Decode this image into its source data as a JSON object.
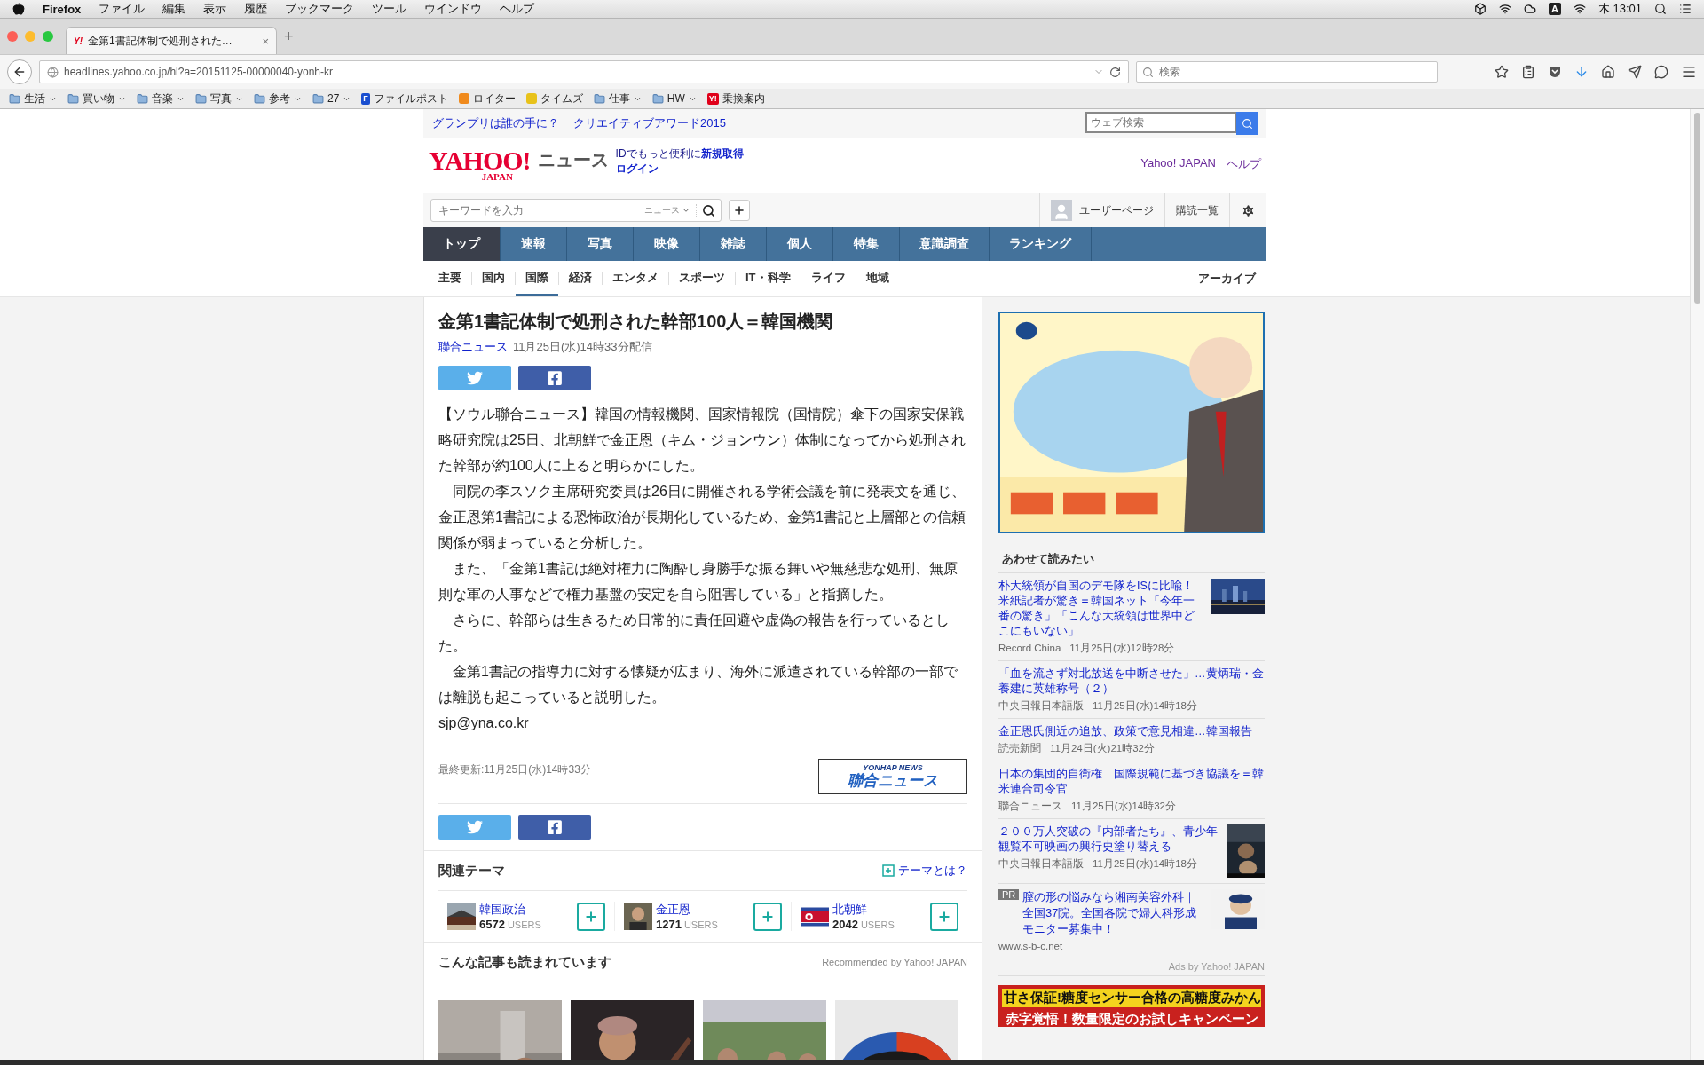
{
  "menubar": {
    "app": "Firefox",
    "items": [
      "ファイル",
      "編集",
      "表示",
      "履歴",
      "ブックマーク",
      "ツール",
      "ウインドウ",
      "ヘルプ"
    ],
    "input_mode": "A",
    "clock": "木 13:01"
  },
  "browser": {
    "tab": {
      "favicon": "Y!",
      "title": "金第1書記体制で処刑された…",
      "close": "×"
    },
    "new_tab": "+",
    "url": "headlines.yahoo.co.jp/hl?a=20151125-00000040-yonh-kr",
    "search_placeholder": "検索",
    "bookmarks": [
      {
        "kind": "folder",
        "label": "生活"
      },
      {
        "kind": "folder",
        "label": "買い物"
      },
      {
        "kind": "folder",
        "label": "音楽"
      },
      {
        "kind": "folder",
        "label": "写真"
      },
      {
        "kind": "folder",
        "label": "参考"
      },
      {
        "kind": "folder",
        "label": "27"
      },
      {
        "kind": "site",
        "label": "ファイルポスト",
        "badge": "F",
        "color": "#1a4fd0"
      },
      {
        "kind": "site",
        "label": "ロイター",
        "color": "#f08a1c"
      },
      {
        "kind": "site",
        "label": "タイムズ",
        "color": "#e8c21a"
      },
      {
        "kind": "folder",
        "label": "仕事"
      },
      {
        "kind": "folder",
        "label": "HW"
      },
      {
        "kind": "site",
        "label": "乗換案内",
        "badge": "Y!",
        "color": "#e0001a"
      }
    ]
  },
  "header": {
    "promo_links": [
      "グランプリは誰の手に？",
      "クリエイティブアワード2015"
    ],
    "web_search_placeholder": "ウェブ検索",
    "logo": {
      "main": "YAHOO!",
      "sub": "JAPAN"
    },
    "site_name": "ニュース",
    "id_prompt": "IDでもっと便利に",
    "signup": "新規取得",
    "login": "ログイン",
    "links": [
      "Yahoo! JAPAN",
      "ヘルプ"
    ],
    "keyword_placeholder": "キーワードを入力",
    "scope": "ニュース",
    "user_page": "ユーザーページ",
    "subscriptions": "購読一覧",
    "nav": [
      {
        "label": "トップ",
        "selected": true
      },
      {
        "label": "速報",
        "selected": false
      },
      {
        "label": "写真",
        "selected": false
      },
      {
        "label": "映像",
        "selected": false
      },
      {
        "label": "雑誌",
        "selected": false
      },
      {
        "label": "個人",
        "selected": false
      },
      {
        "label": "特集",
        "selected": false
      },
      {
        "label": "意識調査",
        "selected": false
      },
      {
        "label": "ランキング",
        "selected": false
      }
    ],
    "subnav": [
      {
        "label": "主要",
        "selected": false
      },
      {
        "label": "国内",
        "selected": false
      },
      {
        "label": "国際",
        "selected": true
      },
      {
        "label": "経済",
        "selected": false
      },
      {
        "label": "エンタメ",
        "selected": false
      },
      {
        "label": "スポーツ",
        "selected": false
      },
      {
        "label": "IT・科学",
        "selected": false
      },
      {
        "label": "ライフ",
        "selected": false
      },
      {
        "label": "地域",
        "selected": false
      }
    ],
    "archive": "アーカイブ"
  },
  "article": {
    "title": "金第1書記体制で処刑された幹部100人＝韓国機関",
    "source": "聯合ニュース",
    "date": "11月25日(水)14時33分配信",
    "paragraphs": [
      "【ソウル聯合ニュース】韓国の情報機関、国家情報院（国情院）傘下の国家安保戦略研究院は25日、北朝鮮で金正恩（キム・ジョンウン）体制になってから処刑された幹部が約100人に上ると明らかにした。",
      "　同院の李スソク主席研究委員は26日に開催される学術会議を前に発表文を通じ、金正恩第1書記による恐怖政治が長期化しているため、金第1書記と上層部との信頼関係が弱まっていると分析した。",
      "　また、「金第1書記は絶対権力に陶酔し身勝手な振る舞いや無慈悲な処刑、無原則な軍の人事などで権力基盤の安定を自ら阻害している」と指摘した。",
      "　さらに、幹部らは生きるため日常的に責任回避や虚偽の報告を行っているとした。",
      "　金第1書記の指導力に対する懐疑が広まり、海外に派遣されている幹部の一部では離脱も起こっていると説明した。"
    ],
    "email": "sjp@yna.co.kr",
    "updated": "最終更新:11月25日(水)14時33分",
    "agency_logo": {
      "en": "YONHAP NEWS",
      "ja": "聯合ニュース"
    }
  },
  "themes": {
    "heading": "関連テーマ",
    "help": "テーマとは？",
    "items": [
      {
        "name": "韓国政治",
        "count": "6572",
        "unit": "USERS"
      },
      {
        "name": "金正恩",
        "count": "1271",
        "unit": "USERS"
      },
      {
        "name": "北朝鮮",
        "count": "2042",
        "unit": "USERS"
      }
    ]
  },
  "recommended": {
    "heading": "こんな記事も読まれています",
    "credit": "Recommended by Yahoo! JAPAN"
  },
  "sidebar": {
    "heading": "あわせて読みたい",
    "items": [
      {
        "title": "朴大統領が自国のデモ隊をISに比喩！米紙記者が驚き＝韓国ネット「今年一番の驚き」「こんな大統領は世界中どこにもいない」",
        "source": "Record China",
        "date": "11月25日(水)12時28分"
      },
      {
        "title": "「血を流さず対北放送を中断させた」…黄炳瑞・金養建に英雄称号（２）",
        "source": "中央日報日本語版",
        "date": "11月25日(水)14時18分"
      },
      {
        "title": "金正恩氏側近の追放、政策で意見相違…韓国報告",
        "source": "読売新聞",
        "date": "11月24日(火)21時32分"
      },
      {
        "title": "日本の集団的自衛権　国際規範に基づき協議を＝韓米連合司令官",
        "source": "聯合ニュース",
        "date": "11月25日(水)14時32分"
      },
      {
        "title": "２００万人突破の『内部者たち』、青少年観覧不可映画の興行史塗り替える",
        "source": "中央日報日本語版",
        "date": "11月25日(水)14時18分"
      }
    ],
    "pr": {
      "badge": "PR",
      "text": "膣の形の悩みなら湘南美容外科｜全国37院。全国各院で婦人科形成モニター募集中！",
      "url": "www.s-b-c.net"
    },
    "ads_credit": "Ads by Yahoo! JAPAN",
    "banner": {
      "line1": "甘さ保証!糖度センサー合格の高糖度みかん",
      "line2": "赤字覚悟！数量限定のお試しキャンペーン"
    }
  }
}
